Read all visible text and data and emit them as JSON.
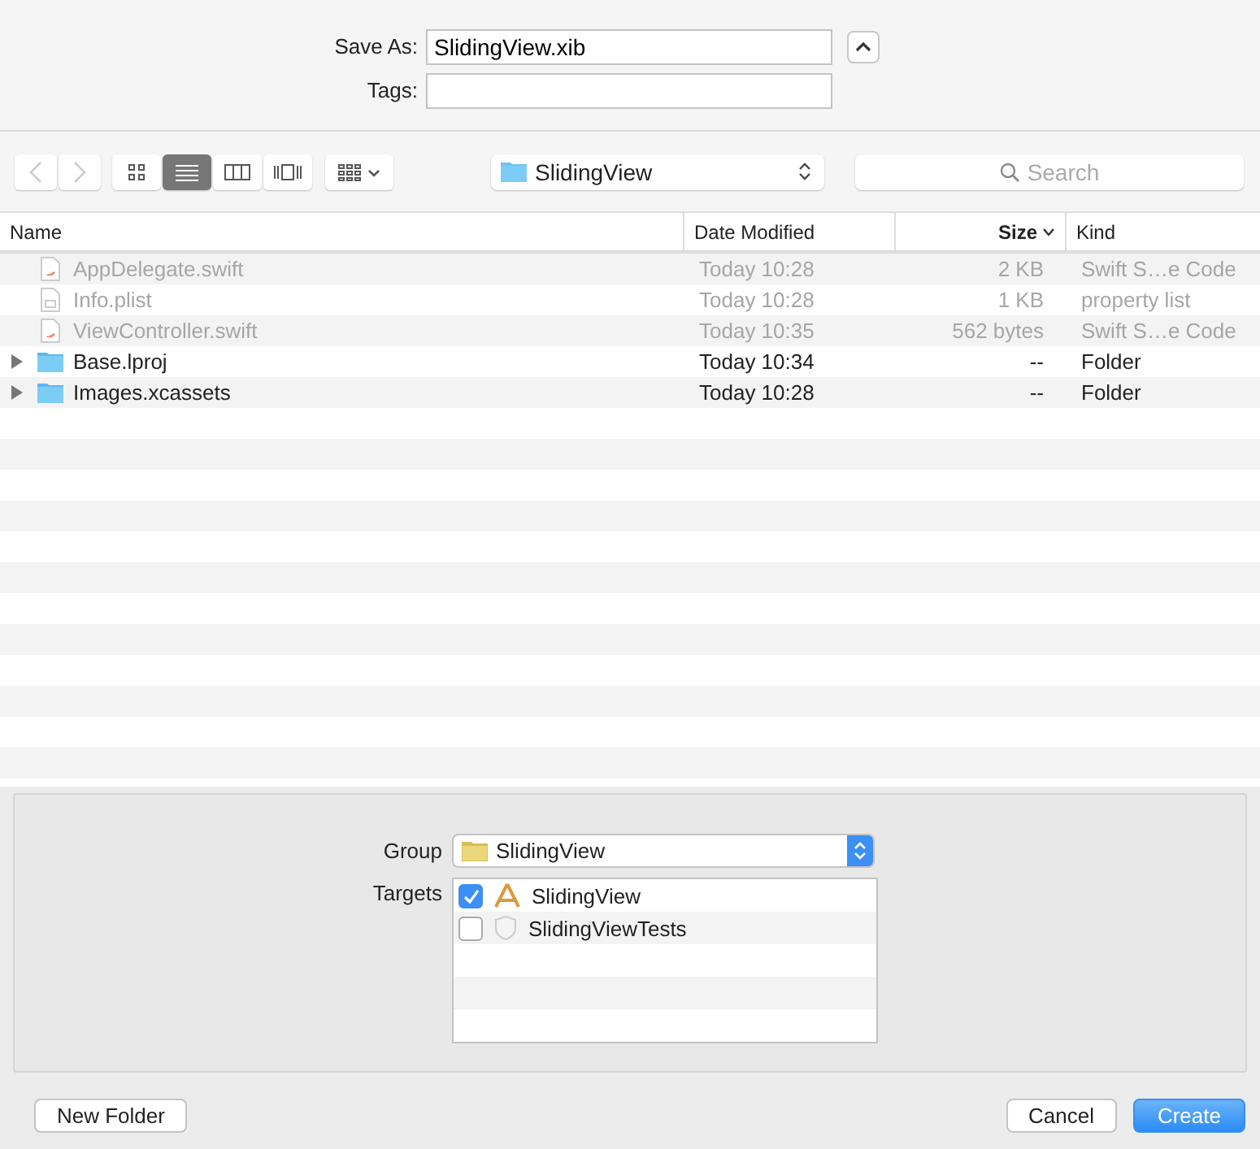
{
  "save_as": {
    "label": "Save As:",
    "value": "SlidingView.xib",
    "expanded": true
  },
  "tags": {
    "label": "Tags:"
  },
  "toolbar": {
    "back_enabled": false,
    "forward_enabled": false,
    "view_modes": [
      {
        "kind": "icons",
        "selected": false
      },
      {
        "kind": "list",
        "selected": true
      },
      {
        "kind": "columns",
        "selected": false
      },
      {
        "kind": "coverflow",
        "selected": false
      }
    ],
    "location": "SlidingView",
    "search": {
      "placeholder": "Search"
    }
  },
  "table": {
    "columns": [
      {
        "label": "Name",
        "sorted": false
      },
      {
        "label": "Date Modified",
        "sorted": false
      },
      {
        "label": "Size",
        "sorted": true
      },
      {
        "label": "Kind",
        "sorted": false
      }
    ],
    "rows": [
      {
        "kind": "swift",
        "name": "AppDelegate.swift",
        "date": "Today 10:28",
        "size": "2 KB",
        "type": "Swift S…e Code",
        "disabled": true
      },
      {
        "kind": "plist",
        "name": "Info.plist",
        "date": "Today 10:28",
        "size": "1 KB",
        "type": "property list",
        "disabled": true
      },
      {
        "kind": "swift",
        "name": "ViewController.swift",
        "date": "Today 10:35",
        "size": "562 bytes",
        "type": "Swift S…e Code",
        "disabled": true
      },
      {
        "kind": "folder",
        "name": "Base.lproj",
        "date": "Today 10:34",
        "size": "--",
        "type": "Folder",
        "disabled": false
      },
      {
        "kind": "folder",
        "name": "Images.xcassets",
        "date": "Today 10:28",
        "size": "--",
        "type": "Folder",
        "disabled": false
      }
    ]
  },
  "group": {
    "label": "Group",
    "value": "SlidingView"
  },
  "targets": {
    "label": "Targets",
    "items": [
      {
        "kind": "app",
        "name": "SlidingView",
        "checked": true
      },
      {
        "kind": "tests",
        "name": "SlidingViewTests",
        "checked": false
      }
    ]
  },
  "buttons": {
    "new_folder": "New Folder",
    "cancel": "Cancel",
    "create": "Create"
  }
}
